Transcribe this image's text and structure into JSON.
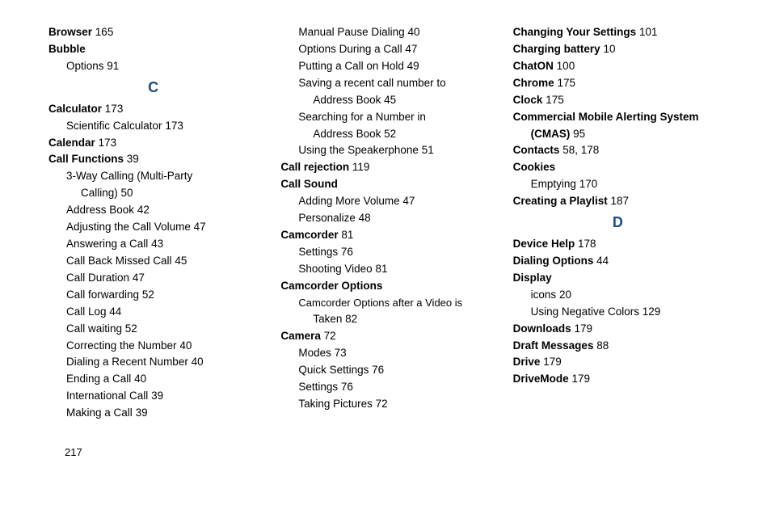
{
  "page_number": "217",
  "col1": {
    "browser": {
      "term": "Browser",
      "pg": "165"
    },
    "bubble": {
      "term": "Bubble"
    },
    "bubble_options": {
      "label": "Options",
      "pg": "91"
    },
    "letter_c": "C",
    "calculator": {
      "term": "Calculator",
      "pg": "173"
    },
    "calculator_sci": {
      "label": "Scientific Calculator",
      "pg": "173"
    },
    "calendar": {
      "term": "Calendar",
      "pg": "173"
    },
    "call_functions": {
      "term": "Call Functions",
      "pg": "39"
    },
    "cf_3way_l1": "3-Way Calling (Multi-Party",
    "cf_3way_l2": {
      "label": "Calling)",
      "pg": "50"
    },
    "cf_address_book": {
      "label": "Address Book",
      "pg": "42"
    },
    "cf_adjust_vol": {
      "label": "Adjusting the Call Volume",
      "pg": "47"
    },
    "cf_answer": {
      "label": "Answering a Call",
      "pg": "43"
    },
    "cf_callback": {
      "label": "Call Back Missed Call",
      "pg": "45"
    },
    "cf_duration": {
      "label": "Call Duration",
      "pg": "47"
    },
    "cf_fwd": {
      "label": "Call forwarding",
      "pg": "52"
    },
    "cf_log": {
      "label": "Call Log",
      "pg": "44"
    },
    "cf_wait": {
      "label": "Call waiting",
      "pg": "52"
    },
    "cf_correct": {
      "label": "Correcting the Number",
      "pg": "40"
    },
    "cf_recent": {
      "label": "Dialing a Recent Number",
      "pg": "40"
    },
    "cf_end": {
      "label": "Ending a Call",
      "pg": "40"
    },
    "cf_intl": {
      "label": "International Call",
      "pg": "39"
    },
    "cf_make": {
      "label": "Making a Call",
      "pg": "39"
    }
  },
  "col2": {
    "cf_manual_pause": {
      "label": "Manual Pause Dialing",
      "pg": "40"
    },
    "cf_opts_during": {
      "label": "Options During a Call",
      "pg": "47"
    },
    "cf_hold": {
      "label": "Putting a Call on Hold",
      "pg": "49"
    },
    "cf_save_recent_l1": "Saving a recent call number to",
    "cf_save_recent_l2": {
      "label": "Address Book",
      "pg": "45"
    },
    "cf_search_l1": "Searching for a Number in",
    "cf_search_l2": {
      "label": "Address Book",
      "pg": "52"
    },
    "cf_spkr": {
      "label": "Using the Speakerphone",
      "pg": "51"
    },
    "call_rejection": {
      "term": "Call rejection",
      "pg": "119"
    },
    "call_sound": {
      "term": "Call Sound"
    },
    "cs_more_vol": {
      "label": "Adding More Volume",
      "pg": "47"
    },
    "cs_personalize": {
      "label": "Personalize",
      "pg": "48"
    },
    "camcorder": {
      "term": "Camcorder",
      "pg": "81"
    },
    "cm_settings": {
      "label": "Settings",
      "pg": "76"
    },
    "cm_shoot": {
      "label": "Shooting Video",
      "pg": "81"
    },
    "camcorder_options": {
      "term": "Camcorder Options"
    },
    "co_after_l1": "Camcorder Options after a Video is",
    "co_after_l2": {
      "label": "Taken",
      "pg": "82"
    },
    "camera": {
      "term": "Camera",
      "pg": "72"
    },
    "ca_modes": {
      "label": "Modes",
      "pg": "73"
    },
    "ca_quick": {
      "label": "Quick Settings",
      "pg": "76"
    },
    "ca_settings": {
      "label": "Settings",
      "pg": "76"
    },
    "ca_taking": {
      "label": "Taking Pictures",
      "pg": "72"
    }
  },
  "col3": {
    "chg_settings": {
      "term": "Changing Your Settings",
      "pg": "101"
    },
    "chg_battery": {
      "term": "Charging battery",
      "pg": "10"
    },
    "chaton": {
      "term": "ChatON",
      "pg": "100"
    },
    "chrome": {
      "term": "Chrome",
      "pg": "175"
    },
    "clock": {
      "term": "Clock",
      "pg": "175"
    },
    "cmas_l1": "Commercial Mobile Alerting System",
    "cmas_l2": {
      "term": "(CMAS)",
      "pg": "95"
    },
    "contacts": {
      "term": "Contacts",
      "pg": "58",
      "sep": ",",
      "pg2": "178"
    },
    "cookies": {
      "term": "Cookies"
    },
    "cookies_empty": {
      "label": "Emptying",
      "pg": "170"
    },
    "playlist": {
      "term": "Creating a Playlist",
      "pg": "187"
    },
    "letter_d": "D",
    "device_help": {
      "term": "Device Help",
      "pg": "178"
    },
    "dial_opts": {
      "term": "Dialing Options",
      "pg": "44"
    },
    "display": {
      "term": "Display"
    },
    "d_icons": {
      "label": "icons",
      "pg": "20"
    },
    "d_neg": {
      "label": "Using Negative Colors",
      "pg": "129"
    },
    "downloads": {
      "term": "Downloads",
      "pg": "179"
    },
    "draft": {
      "term": "Draft Messages",
      "pg": "88"
    },
    "drive": {
      "term": "Drive",
      "pg": "179"
    },
    "drivemode": {
      "term": "DriveMode",
      "pg": "179"
    }
  }
}
